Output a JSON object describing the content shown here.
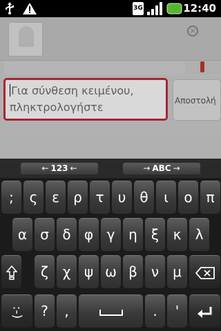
{
  "status_bar": {
    "time": "12:40",
    "network_type": "3G",
    "icons": [
      "usb-icon",
      "warning-icon",
      "network-3g-icon",
      "signal-icon",
      "battery-icon"
    ]
  },
  "conversation": {
    "close_symbol": "×"
  },
  "compose": {
    "placeholder_line1": "Για σύνθεση κειμένου,",
    "placeholder_line2": "πληκτρολογήστε",
    "send_label": "Αποστολή",
    "accent_color": "#c12d3d"
  },
  "keyboard": {
    "lang_left": {
      "arrow": "←",
      "label": "123",
      "arrow2": "←"
    },
    "lang_right": {
      "arrow": "→",
      "label": "ABC",
      "arrow2": "→"
    },
    "row1": [
      ";",
      "ς",
      "ε",
      "ρ",
      "τ",
      "υ",
      "θ",
      "ι",
      "ο",
      "π"
    ],
    "row2": [
      "α",
      "σ",
      "δ",
      "φ",
      "γ",
      "η",
      "ξ",
      "κ",
      "λ"
    ],
    "row3": [
      "ζ",
      "χ",
      "ψ",
      "ω",
      "β",
      "ν",
      "μ"
    ],
    "row4": {
      "smiley": ":-)",
      "question": "?",
      "comma": ",",
      "period": ".",
      "apostrophe": "'"
    }
  }
}
